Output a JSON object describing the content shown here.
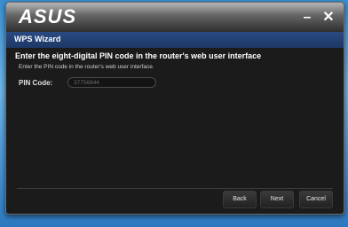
{
  "window": {
    "logo_text": "ASUS",
    "minimize_glyph": "–",
    "close_glyph": "✕"
  },
  "wizard": {
    "title": "WPS Wizard",
    "heading": "Enter the eight-digital PIN code in the router's web user interface",
    "subtext": "Enter the PIN code in the router's web user interface.",
    "pin_label": "PIN Code:",
    "pin_value": "37756844"
  },
  "buttons": {
    "back": "Back",
    "next": "Next",
    "cancel": "Cancel"
  },
  "colors": {
    "header_blue": "#1d3766",
    "background": "#1b1b1b"
  }
}
